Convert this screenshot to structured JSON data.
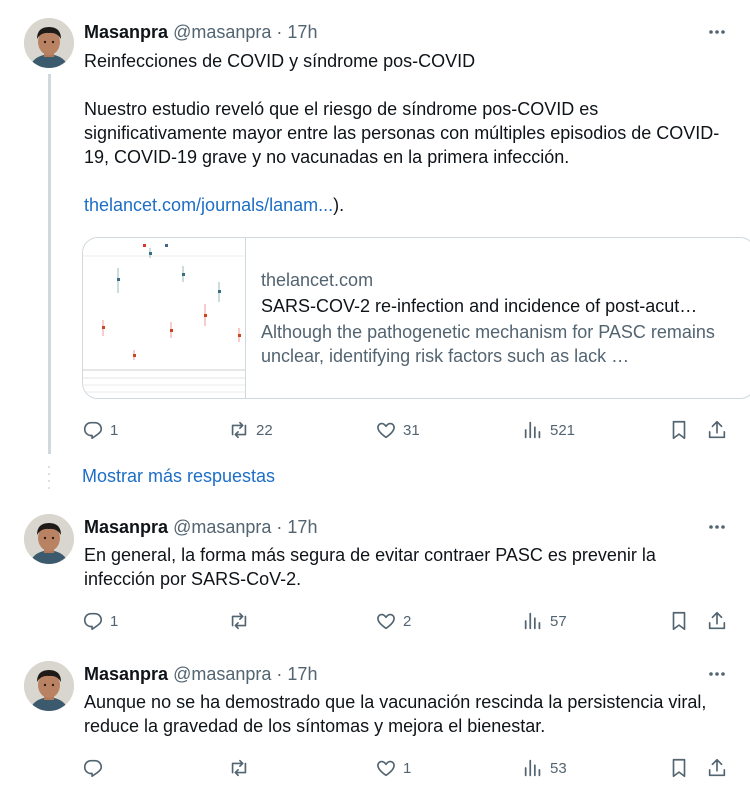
{
  "tweets": [
    {
      "name": "Masanpra",
      "handle": "@masanpra",
      "sep": "·",
      "time": "17h",
      "lines": [
        "Reinfecciones de COVID y síndrome pos-COVID",
        "",
        "Nuestro estudio reveló que el riesgo de síndrome pos-COVID es significativamente mayor entre las personas con múltiples episodios de COVID-19, COVID-19 grave y no vacunadas en la primera infección.",
        ""
      ],
      "link": "thelancet.com/journals/lanam...",
      "link_suffix": ").",
      "card": {
        "domain": "thelancet.com",
        "title": "SARS-COV-2 re-infection and incidence of post-acut…",
        "description": "Although the pathogenetic mechanism for PASC remains unclear, identifying risk factors such as lack …"
      },
      "replies": "1",
      "retweets": "22",
      "likes": "31",
      "views": "521"
    },
    {
      "name": "Masanpra",
      "handle": "@masanpra",
      "sep": "·",
      "time": "17h",
      "text": "En general, la forma más segura de evitar contraer PASC es prevenir la infección por SARS-CoV-2.",
      "replies": "1",
      "retweets": "",
      "likes": "2",
      "views": "57"
    },
    {
      "name": "Masanpra",
      "handle": "@masanpra",
      "sep": "·",
      "time": "17h",
      "text": "Aunque no se ha demostrado que la vacunación rescinda la persistencia viral, reduce la gravedad de los síntomas y mejora el bienestar.",
      "replies": "",
      "retweets": "",
      "likes": "1",
      "views": "53"
    }
  ],
  "show_more": "Mostrar más respuestas",
  "colors": {
    "link": "#1d6ec6",
    "muted": "#536471",
    "border": "#cfd9de"
  },
  "icons": [
    "reply-icon",
    "retweet-icon",
    "like-icon",
    "views-icon",
    "bookmark-icon",
    "share-icon",
    "more-icon"
  ]
}
